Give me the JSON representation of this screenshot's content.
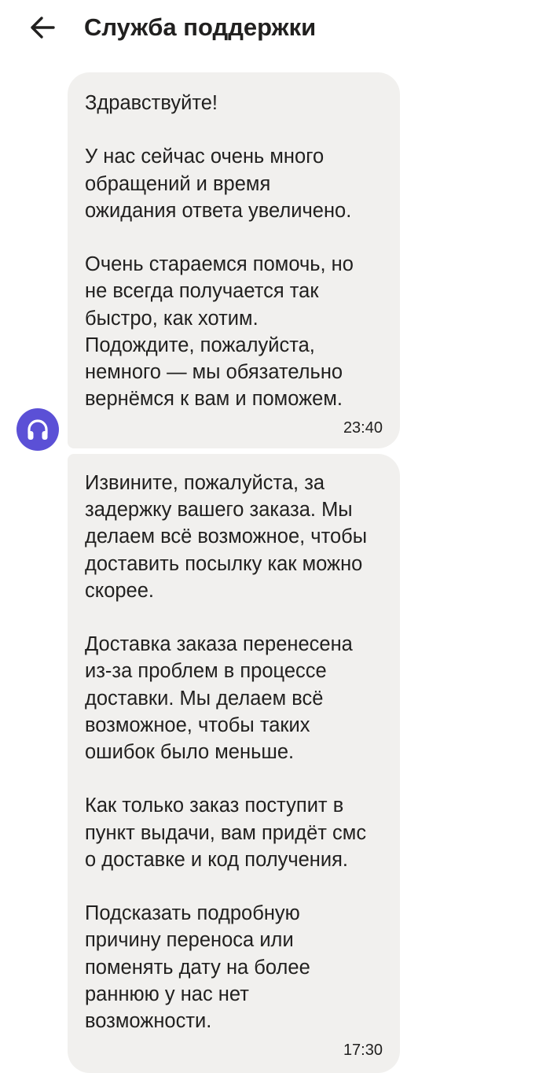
{
  "header": {
    "back_icon": "arrow-left-icon",
    "title": "Служба поддержки"
  },
  "support_avatar": {
    "icon": "headphones-icon",
    "color": "#5b50d6"
  },
  "messages": [
    {
      "text": "Здравствуйте!\n\nУ нас сейчас очень много\nобращений и время\nожидания ответа увеличено.\n\nОчень стараемся помочь, но\nне всегда получается так\nбыстро, как хотим.\nПодождите, пожалуйста,\nнемного — мы обязательно\nвернёмся к вам и поможем.",
      "time": "23:40"
    },
    {
      "text": "Извините, пожалуйста, за\nзадержку вашего заказа. Мы\nделаем всё возможное, чтобы\nдоставить посылку как можно\nскорее.\n\nДоставка заказа перенесена\nиз-за проблем в процессе\nдоставки. Мы делаем всё\nвозможное, чтобы таких\nошибок было меньше.\n\nКак только заказ поступит в\nпункт выдачи, вам придёт смс\nо доставке и код получения.\n\nПодсказать подробную\nпричину переноса или\nпоменять дату на более\nраннюю у нас нет\nвозможности.",
      "time": "17:30"
    }
  ],
  "colors": {
    "bubble_background": "#f1f0ee",
    "text": "#21201f"
  }
}
